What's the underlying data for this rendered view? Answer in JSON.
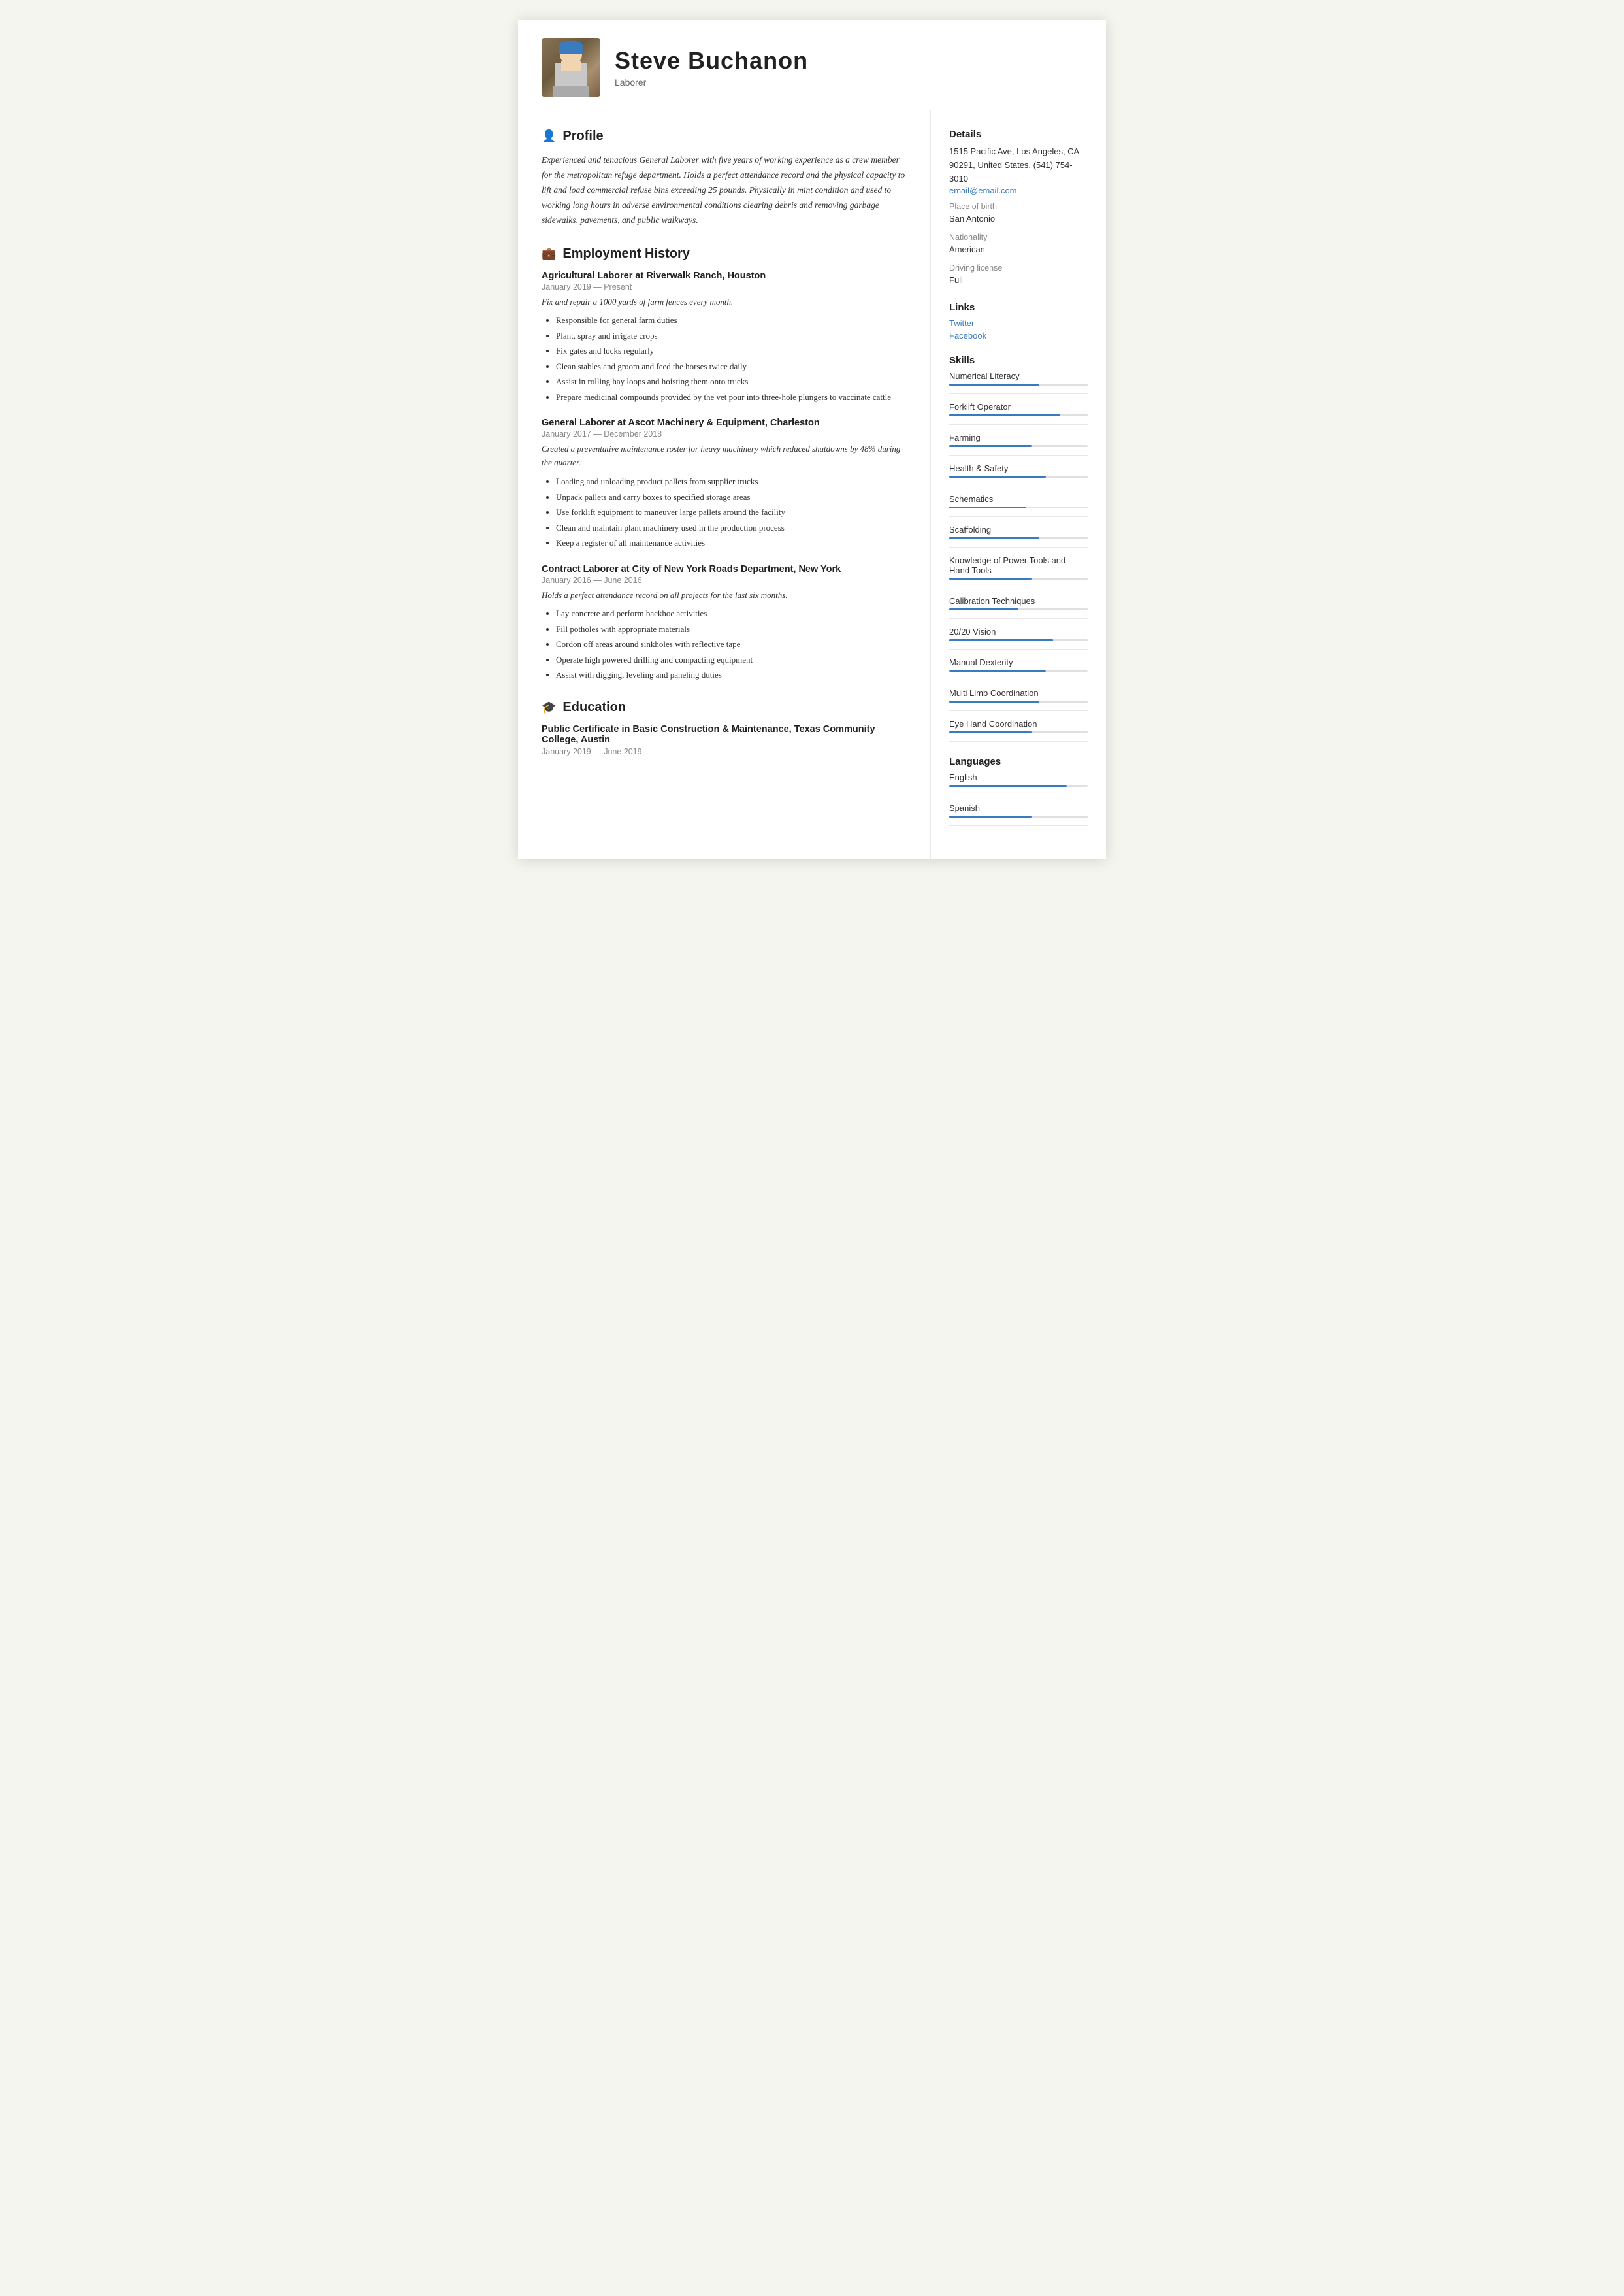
{
  "header": {
    "name": "Steve  Buchanon",
    "title": "Laborer"
  },
  "profile": {
    "section_title": "Profile",
    "icon": "👤",
    "text": "Experienced and tenacious General Laborer with five years of working experience as a crew member for the metropolitan refuge department. Holds a perfect attendance record and the physical capacity to lift and load commercial refuse bins exceeding 25 pounds. Physically in mint condition and used to working long hours in adverse environmental conditions clearing debris and removing garbage sidewalks, pavements, and public walkways."
  },
  "employment": {
    "section_title": "Employment History",
    "icon": "💼",
    "jobs": [
      {
        "title": "Agricultural Laborer at  Riverwalk Ranch, Houston",
        "dates": "January 2019 — Present",
        "summary": "Fix and repair a 1000 yards of farm fences every month.",
        "bullets": [
          "Responsible for general farm duties",
          "Plant, spray and irrigate crops",
          "Fix gates and locks regularly",
          "Clean stables and groom and feed the horses twice daily",
          "Assist in rolling hay loops and hoisting them onto trucks",
          "Prepare  medicinal compounds provided by the vet pour into three-hole plungers to     vaccinate cattle"
        ]
      },
      {
        "title": "General Laborer at  Ascot Machinery & Equipment, Charleston",
        "dates": "January 2017 — December 2018",
        "summary": "Created a preventative maintenance roster for heavy machinery which reduced shutdowns by 48% during the quarter.",
        "bullets": [
          "Loading and unloading product pallets from supplier trucks",
          "Unpack pallets  and carry boxes to specified storage areas",
          "Use forklift equipment to maneuver large pallets around the facility",
          "Clean and maintain plant machinery used in the production process",
          "Keep a register of all maintenance activities"
        ]
      },
      {
        "title": "Contract Laborer at  City of New York Roads Department, New York",
        "dates": "January 2016 — June 2016",
        "summary": "Holds a perfect attendance record on all projects for the last six months.",
        "bullets": [
          "Lay concrete and perform backhoe activities",
          "Fill potholes with appropriate materials",
          "Cordon off areas around sinkholes with reflective tape",
          "Operate high powered drilling and compacting equipment",
          "Assist with digging, leveling and paneling duties"
        ]
      }
    ]
  },
  "education": {
    "section_title": "Education",
    "icon": "🎓",
    "items": [
      {
        "title": "Public Certificate in Basic Construction & Maintenance, Texas Community College, Austin",
        "dates": "January 2019 — June 2019"
      }
    ]
  },
  "details": {
    "section_title": "Details",
    "address": "1515 Pacific Ave, Los Angeles, CA 90291, United States, (541) 754-3010",
    "email": "email@email.com",
    "place_of_birth_label": "Place of birth",
    "place_of_birth": "San Antonio",
    "nationality_label": "Nationality",
    "nationality": "American",
    "driving_license_label": "Driving license",
    "driving_license": "Full"
  },
  "links": {
    "section_title": "Links",
    "items": [
      {
        "label": "Twitter",
        "url": "#"
      },
      {
        "label": "Facebook",
        "url": "#"
      }
    ]
  },
  "skills": {
    "section_title": "Skills",
    "items": [
      {
        "name": "Numerical Literacy",
        "pct": 65
      },
      {
        "name": "Forklift Operator",
        "pct": 80
      },
      {
        "name": "Farming",
        "pct": 60
      },
      {
        "name": "Health & Safety",
        "pct": 70
      },
      {
        "name": "Schematics",
        "pct": 55
      },
      {
        "name": "Scaffolding",
        "pct": 65
      },
      {
        "name": "Knowledge of Power Tools and Hand Tools",
        "pct": 60
      },
      {
        "name": "Calibration Techniques",
        "pct": 50
      },
      {
        "name": "20/20 Vision",
        "pct": 75
      },
      {
        "name": "Manual Dexterity",
        "pct": 70
      },
      {
        "name": "Multi Limb Coordination",
        "pct": 65
      },
      {
        "name": "Eye Hand Coordination",
        "pct": 60
      }
    ]
  },
  "languages": {
    "section_title": "Languages",
    "items": [
      {
        "name": "English",
        "pct": 85
      },
      {
        "name": "Spanish",
        "pct": 60
      }
    ]
  }
}
